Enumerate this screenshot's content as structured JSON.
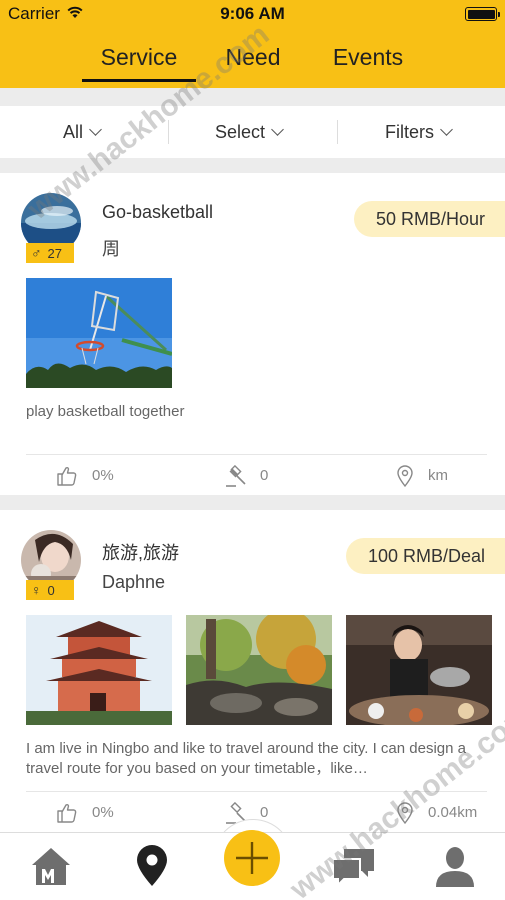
{
  "status_bar": {
    "carrier": "Carrier",
    "time": "9:06 AM"
  },
  "tabs": [
    {
      "label": "Service",
      "active": true
    },
    {
      "label": "Need",
      "active": false
    },
    {
      "label": "Events",
      "active": false
    }
  ],
  "filters": [
    {
      "label": "All"
    },
    {
      "label": "Select"
    },
    {
      "label": "Filters"
    }
  ],
  "cards": [
    {
      "title": "Go-basketball",
      "subtitle": "周",
      "gender_symbol": "♂",
      "age": "27",
      "price": "50 RMB/Hour",
      "description": "play basketball together",
      "like_percent": "0%",
      "bids": "0",
      "distance": "km"
    },
    {
      "title": "旅游,旅游",
      "subtitle": "Daphne",
      "gender_symbol": "♀",
      "age": "0",
      "price": "100 RMB/Deal",
      "description": "I am live in Ningbo and like to travel around the city. I can design a travel route for you based on your timetable，like…",
      "like_percent": "0%",
      "bids": "0",
      "distance": "0.04km"
    }
  ],
  "watermark": "www.hackhome.com",
  "colors": {
    "brand_yellow": "#f8c015",
    "price_pill": "#fdf0c2"
  },
  "icons": {
    "wifi": "wifi-icon",
    "battery": "battery-icon",
    "like": "thumbs-up-icon",
    "bid": "gavel-icon",
    "location": "location-pin-icon",
    "nav": [
      "home-icon",
      "map-pin-icon",
      "add-icon",
      "chat-icon",
      "profile-icon"
    ]
  }
}
